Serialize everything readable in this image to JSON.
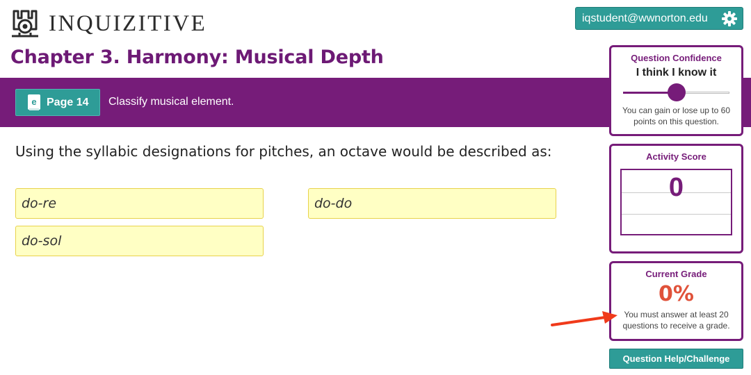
{
  "header": {
    "logo_text": "INQUIZITIVE",
    "user_email": "iqstudent@wwnorton.edu"
  },
  "chapter_title": "Chapter 3. Harmony: Musical Depth",
  "band": {
    "page_label": "Page 14",
    "instruction": "Classify musical element."
  },
  "question": {
    "text": "Using the syllabic designations for pitches, an octave would be described as:",
    "answers": [
      "do-re",
      "do-do",
      "do-sol"
    ]
  },
  "confidence": {
    "title": "Question Confidence",
    "value": "I think I know it",
    "slider_level": 0.5,
    "note": "You can gain or lose up to 60 points on this question."
  },
  "activity_score": {
    "title": "Activity Score",
    "value": "0"
  },
  "grade": {
    "title": "Current Grade",
    "value": "0%",
    "note": "You must answer at least 20 questions to receive a grade."
  },
  "help_button": "Question Help/Challenge",
  "colors": {
    "purple": "#761c79",
    "teal": "#2e9c97",
    "answer_bg": "#ffffc4",
    "grade_red": "#e0523a",
    "arrow_red": "#f03a1a"
  }
}
